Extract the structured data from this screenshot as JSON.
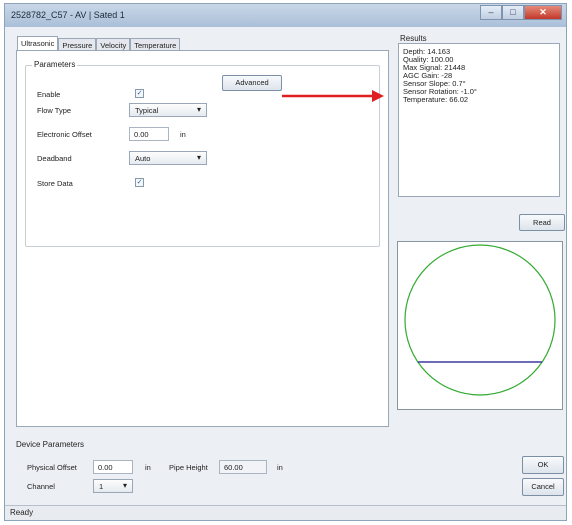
{
  "window": {
    "title": "2528782_C57 - AV | Sated 1",
    "controls": {
      "minimize": "–",
      "maximize": "□",
      "close": "✕"
    }
  },
  "tabs": [
    {
      "label": "Ultrasonic",
      "active": true
    },
    {
      "label": "Pressure",
      "active": false
    },
    {
      "label": "Velocity",
      "active": false
    },
    {
      "label": "Temperature",
      "active": false
    }
  ],
  "parameters": {
    "group_title": "Parameters",
    "enable_label": "Enable",
    "enable_checked": true,
    "flow_type_label": "Flow Type",
    "flow_type_value": "Typical",
    "electronic_offset_label": "Electronic Offset",
    "electronic_offset_value": "0.00",
    "electronic_offset_unit": "in",
    "deadband_label": "Deadband",
    "deadband_value": "Auto",
    "store_data_label": "Store Data",
    "store_data_checked": true,
    "advanced_button": "Advanced"
  },
  "results": {
    "label": "Results",
    "lines": [
      "Depth: 14.163",
      "Quality: 100.00",
      "Max Signal: 21448",
      "AGC Gain: -28",
      "Sensor Slope: 0.7°",
      "Sensor Rotation: -1.0°",
      "Temperature: 66.02"
    ],
    "read_button": "Read"
  },
  "scope": {
    "circle_color": "#33aa33",
    "level_color": "#3a3aa0",
    "fill_level_fraction": 0.22
  },
  "device": {
    "group_title": "Device Parameters",
    "physical_offset_label": "Physical Offset",
    "physical_offset_value": "0.00",
    "physical_offset_unit": "in",
    "pipe_height_label": "Pipe Height",
    "pipe_height_value": "60.00",
    "pipe_height_unit": "in",
    "channel_label": "Channel",
    "channel_value": "1"
  },
  "buttons": {
    "ok": "OK",
    "cancel": "Cancel"
  },
  "status": {
    "text": "Ready"
  },
  "annotation": {
    "arrow_color": "#e02020"
  }
}
